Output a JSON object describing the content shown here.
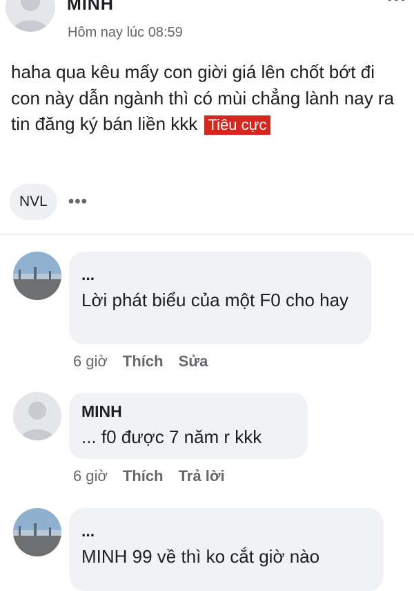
{
  "post": {
    "author": "MINH",
    "time": "Hôm nay lúc 08:59",
    "menu_icon": "more-dots-icon",
    "text": "haha qua kêu mấy con giời giá lên chốt bớt đi con này dẫn ngành thì có mùi chẳng lành nay ra tin đăng ký bán liền kkk",
    "sentiment_tag": "Tiêu cực",
    "sentiment_color": "#d7261e",
    "ticker_chip": "NVL",
    "more_label": "•••"
  },
  "comments": [
    {
      "name": "...",
      "text": "Lời phát biểu của một F0 cho hay",
      "time": "6 giờ",
      "action1": "Thích",
      "action2": "Sửa",
      "avatar": "landscape-avatar"
    },
    {
      "name": "MINH",
      "text": "...  f0 được 7 năm r kkk",
      "time": "6 giờ",
      "action1": "Thích",
      "action2": "Trả lời",
      "avatar": "default-avatar"
    },
    {
      "name": "...",
      "text": "MINH 99 về thì ko cắt giờ nào",
      "avatar": "landscape-avatar"
    }
  ]
}
